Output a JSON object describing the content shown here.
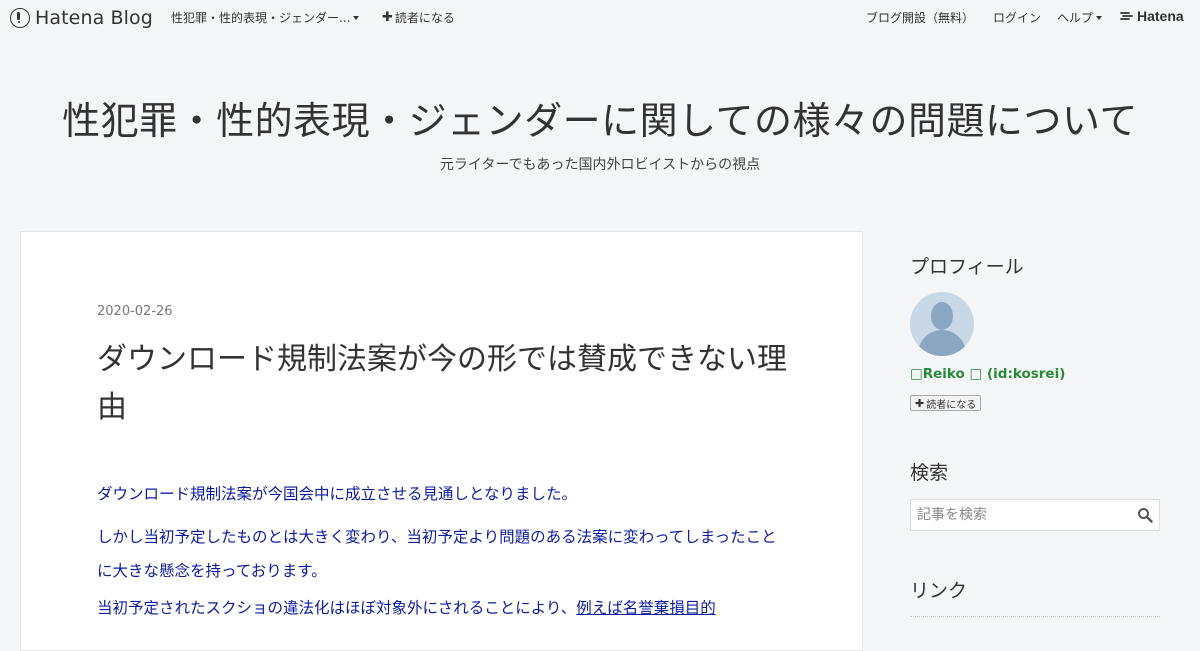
{
  "topbar": {
    "brand": "Hatena Blog",
    "blog_menu": "性犯罪・性的表現・ジェンダー...",
    "follow": "読者になる",
    "open_blog": "ブログ開設（無料）",
    "login": "ログイン",
    "help": "ヘルプ",
    "hatena": "Hatena"
  },
  "header": {
    "title": "性犯罪・性的表現・ジェンダーに関しての様々の問題について",
    "description": "元ライターでもあった国内外ロビイストからの視点"
  },
  "entry": {
    "date": "2020-02-26",
    "title": "ダウンロード規制法案が今の形では賛成できない理由",
    "paragraphs": [
      "ダウンロード規制法案が今国会中に成立させる見通しとなりました。",
      "しかし当初予定したものとは大きく変わり、当初予定より問題のある法案に変わってしまったことに大きな懸念を持っております。",
      "当初予定されたスクショの違法化はほぼ対象外にされることにより、"
    ],
    "link_text": "例えば名誉棄損目的"
  },
  "sidebar": {
    "profile_heading": "プロフィール",
    "profile_name": "□Reiko □ (id:kosrei)",
    "reader_button": "読者になる",
    "search_heading": "検索",
    "search_placeholder": "記事を検索",
    "links_heading": "リンク"
  }
}
